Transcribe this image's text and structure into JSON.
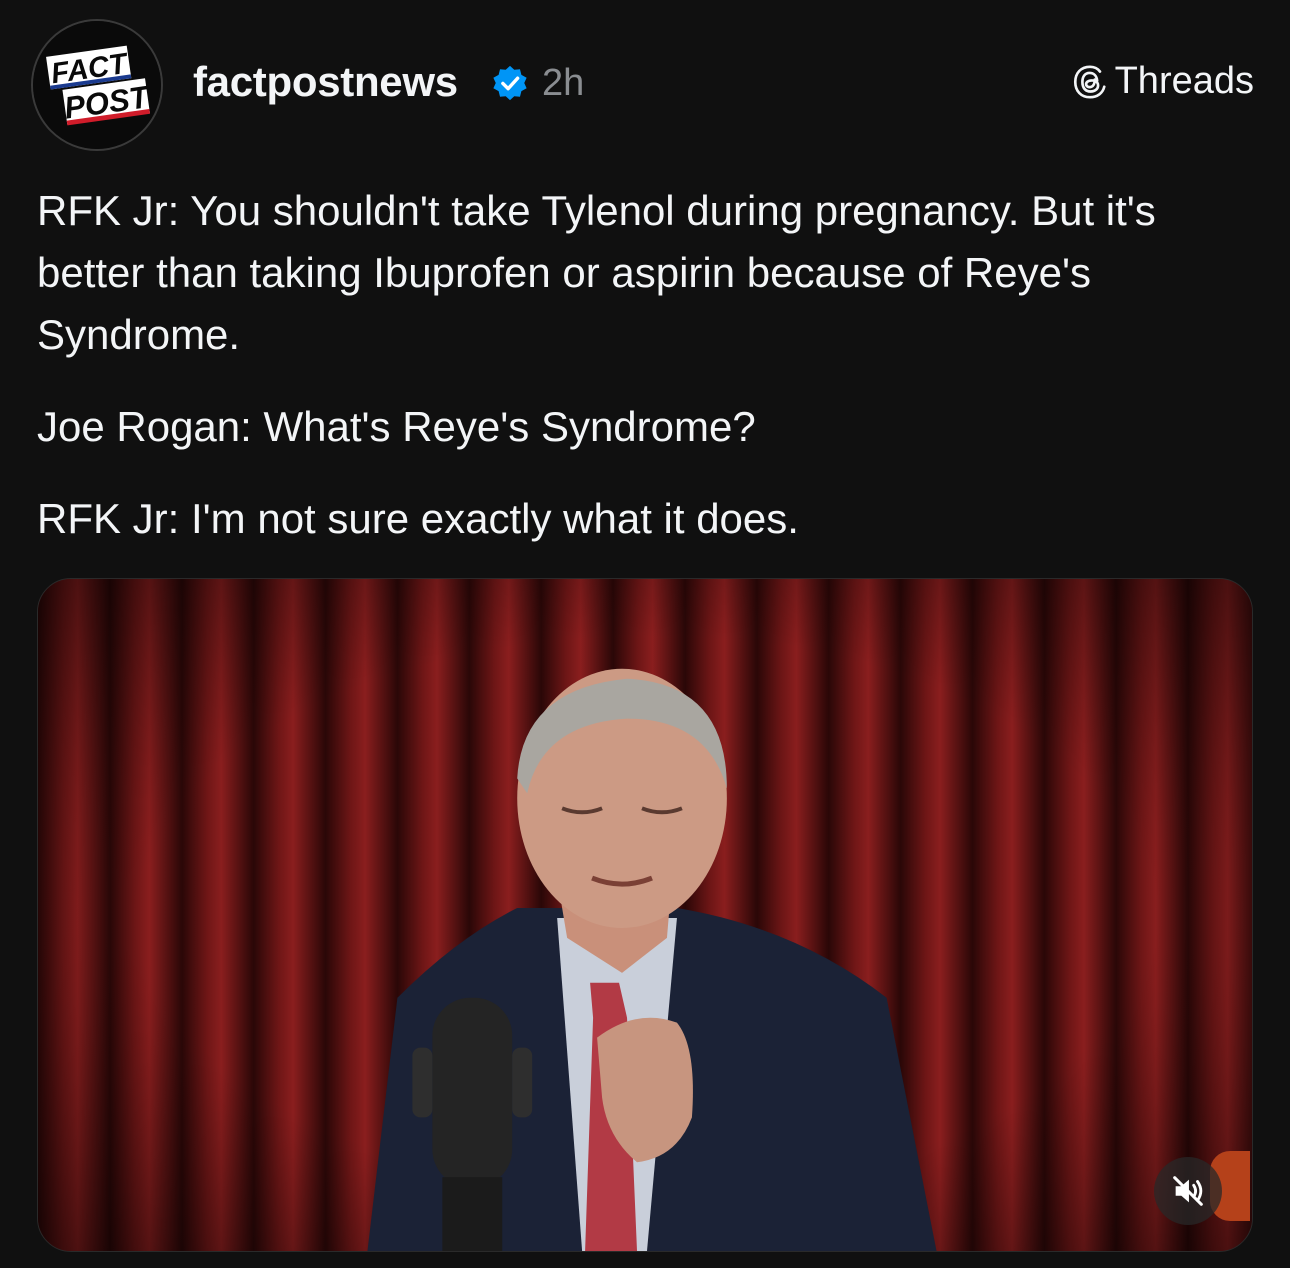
{
  "header": {
    "avatar_text_top": "FACT",
    "avatar_text_bottom": "POST",
    "username": "factpostnews",
    "verified": "verified-badge-icon",
    "time": "2h",
    "platform_label": "Threads"
  },
  "post": {
    "paragraphs": [
      "RFK Jr: You shouldn't take Tylenol during pregnancy. But it's better than taking Ibuprofen or aspirin because of Reye's Syndrome.",
      "Joe Rogan: What's Reye's Syndrome?",
      "RFK Jr: I'm not sure exactly what it does."
    ]
  },
  "media": {
    "type": "video",
    "mute_icon": "muted-speaker-icon"
  },
  "colors": {
    "background": "#101010",
    "text": "#f3f5f7",
    "muted_text": "#8a8d91",
    "verified_blue": "#0095f6"
  }
}
